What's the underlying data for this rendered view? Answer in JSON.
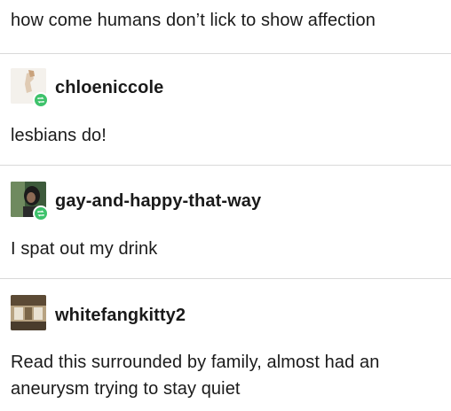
{
  "original_post": {
    "text": "how come humans don’t lick to show affection"
  },
  "replies": [
    {
      "username": "chloeniccole",
      "text": "lesbians do!",
      "reblog_icon": "reblog-icon",
      "avatar_icon": "avatar-chloeniccole"
    },
    {
      "username": "gay-and-happy-that-way",
      "text": "I spat out my drink",
      "reblog_icon": "reblog-icon",
      "avatar_icon": "avatar-gay-and-happy-that-way"
    },
    {
      "username": "whitefangkitty2",
      "text_lines": [
        "Read this surrounded by family, almost had an",
        "aneurysm trying to stay quiet"
      ],
      "avatar_icon": "avatar-whitefangkitty2"
    }
  ],
  "colors": {
    "badge_green": "#3ec26b",
    "divider": "#d9d9d9",
    "text": "#1a1a1a"
  }
}
